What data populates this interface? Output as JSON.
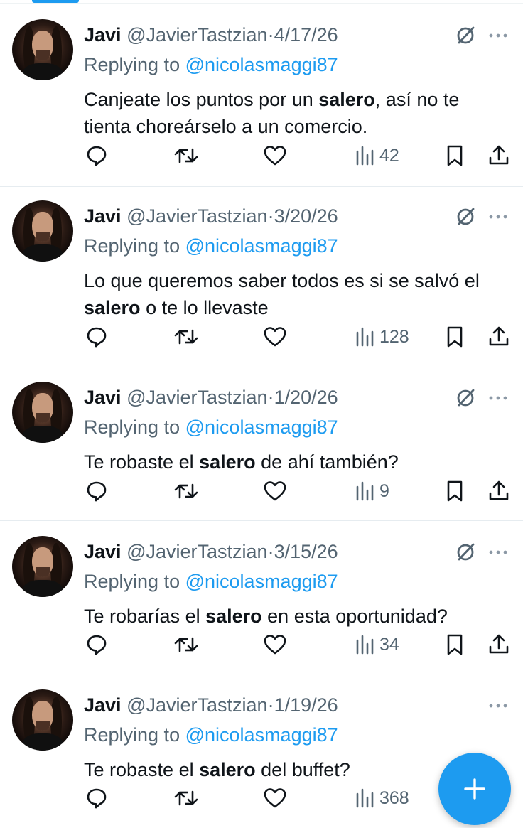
{
  "author": {
    "name": "Javi",
    "handle": "@JavierTastzian"
  },
  "replying_prefix": "Replying to",
  "reply_target": "@nicolasmaggi87",
  "separator": "·",
  "keyword": "salero",
  "accent_color": "#1d9bf0",
  "tweets": [
    {
      "date": "4/17/26",
      "text_before": "Canjeate los puntos por un ",
      "text_after": ", así no te tienta choreárselo a un comercio.",
      "views": "42",
      "has_ban_icon": true
    },
    {
      "date": "3/20/26",
      "text_before": "Lo que queremos saber todos es si se salvó el ",
      "text_after": " o te lo llevaste",
      "views": "128",
      "has_ban_icon": true
    },
    {
      "date": "1/20/26",
      "text_before": "Te robaste el ",
      "text_after": " de ahí también?",
      "views": "9",
      "has_ban_icon": true
    },
    {
      "date": "3/15/26",
      "text_before": "Te robarías el ",
      "text_after": " en esta oportunidad?",
      "views": "34",
      "has_ban_icon": true
    },
    {
      "date": "1/19/26",
      "text_before": "Te robaste el ",
      "text_after": " del buffet?",
      "views": "368",
      "has_ban_icon": false
    }
  ],
  "icons": [
    "reply-icon",
    "retweet-icon",
    "like-icon",
    "views-icon",
    "bookmark-icon",
    "share-icon",
    "no-entry-icon",
    "more-icon",
    "compose-plus-icon"
  ]
}
